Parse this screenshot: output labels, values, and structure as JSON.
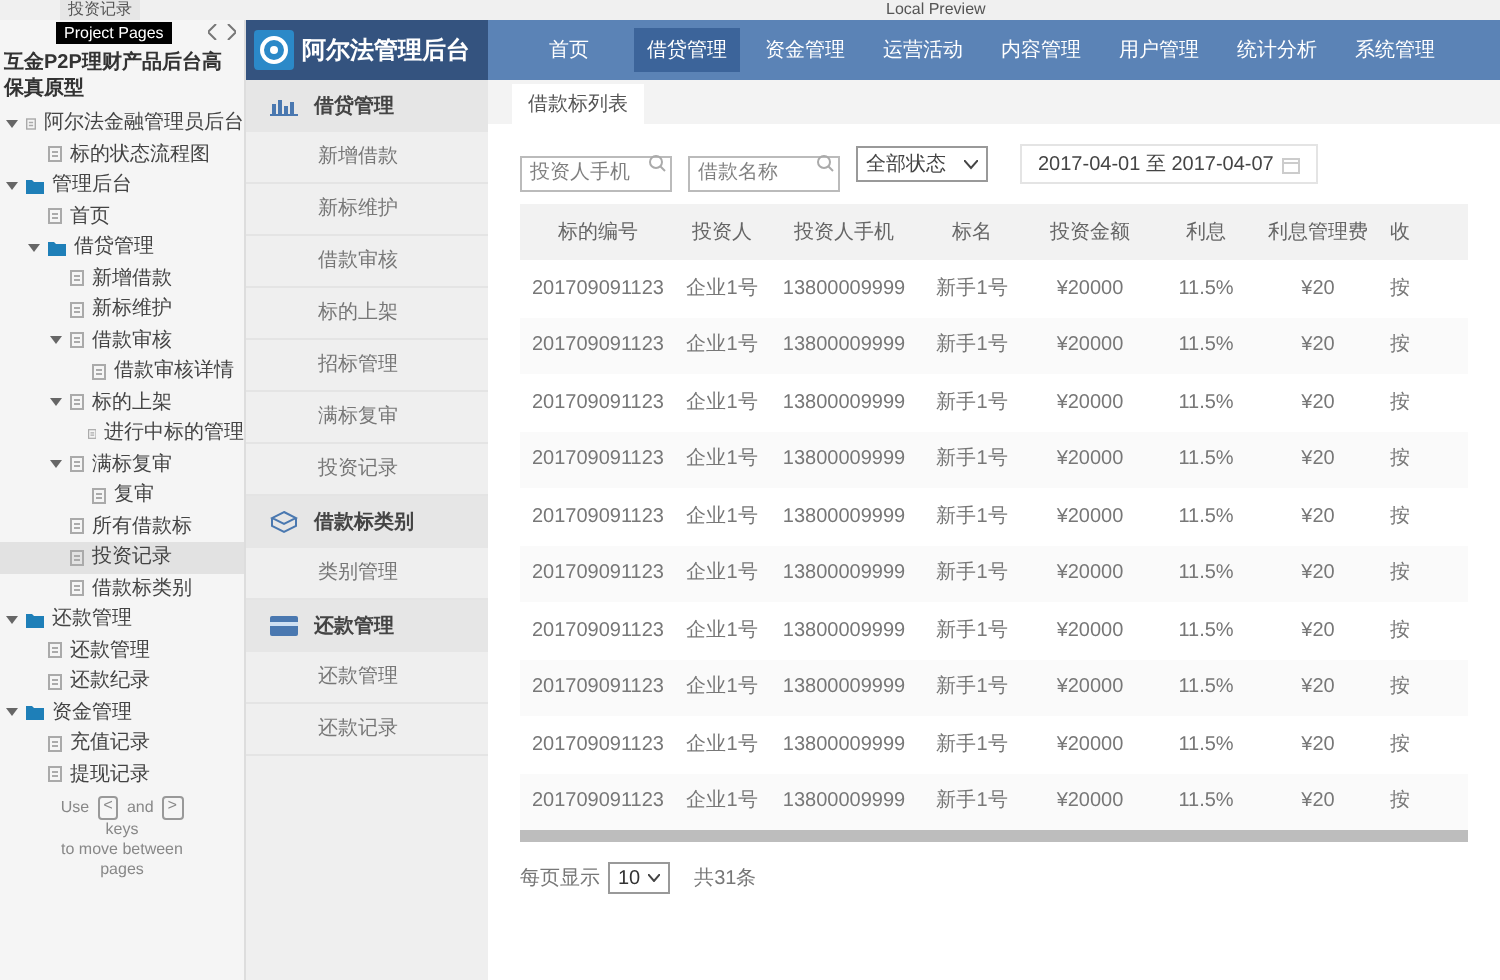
{
  "top_bar": {
    "page_tab": "投资记录",
    "title": "Local Preview"
  },
  "pages_panel": {
    "tooltip": "Project Pages",
    "project_title": "互金P2P理财产品后台高保真原型",
    "tree": [
      {
        "label": "阿尔法金融管理员后台",
        "kind": "page",
        "expanded": true,
        "selected": false,
        "children": [
          {
            "label": "标的状态流程图",
            "kind": "page",
            "selected": false
          }
        ]
      },
      {
        "label": "管理后台",
        "kind": "folder",
        "expanded": true,
        "selected": false,
        "children": [
          {
            "label": "首页",
            "kind": "page",
            "selected": false
          },
          {
            "label": "借贷管理",
            "kind": "folder",
            "expanded": true,
            "selected": false,
            "children": [
              {
                "label": "新增借款",
                "kind": "page",
                "selected": false
              },
              {
                "label": "新标维护",
                "kind": "page",
                "selected": false
              },
              {
                "label": "借款审核",
                "kind": "page",
                "expanded": true,
                "selected": false,
                "children": [
                  {
                    "label": "借款审核详情",
                    "kind": "page",
                    "selected": false
                  }
                ]
              },
              {
                "label": "标的上架",
                "kind": "page",
                "expanded": true,
                "selected": false,
                "children": [
                  {
                    "label": "进行中标的管理",
                    "kind": "page",
                    "selected": false
                  }
                ]
              },
              {
                "label": "满标复审",
                "kind": "page",
                "expanded": true,
                "selected": false,
                "children": [
                  {
                    "label": "复审",
                    "kind": "page",
                    "selected": false
                  }
                ]
              },
              {
                "label": "所有借款标",
                "kind": "page",
                "selected": false
              },
              {
                "label": "投资记录",
                "kind": "page",
                "selected": true
              },
              {
                "label": "借款标类别",
                "kind": "page",
                "selected": false
              }
            ]
          }
        ]
      },
      {
        "label": "还款管理",
        "kind": "folder",
        "expanded": true,
        "selected": false,
        "children": [
          {
            "label": "还款管理",
            "kind": "page",
            "selected": false
          },
          {
            "label": "还款纪录",
            "kind": "page",
            "selected": false
          }
        ]
      },
      {
        "label": "资金管理",
        "kind": "folder",
        "expanded": true,
        "selected": false,
        "children": [
          {
            "label": "充值记录",
            "kind": "page",
            "selected": false
          },
          {
            "label": "提现记录",
            "kind": "page",
            "selected": false
          }
        ]
      }
    ],
    "hint": {
      "before": "Use",
      "prev_key": "<",
      "middle": "and",
      "next_key": ">",
      "line_2": "keys",
      "line_3": "to move between",
      "line_4": "pages"
    }
  },
  "app": {
    "logo_text": "阿尔法管理后台",
    "nav": [
      {
        "label": "首页",
        "selected": false
      },
      {
        "label": "借贷管理",
        "selected": true
      },
      {
        "label": "资金管理",
        "selected": false
      },
      {
        "label": "运营活动",
        "selected": false
      },
      {
        "label": "内容管理",
        "selected": false
      },
      {
        "label": "用户管理",
        "selected": false
      },
      {
        "label": "统计分析",
        "selected": false
      },
      {
        "label": "系统管理",
        "selected": false
      }
    ],
    "sidebar": [
      {
        "label": "借贷管理",
        "kind": "chart",
        "items": [
          {
            "label": "新增借款"
          },
          {
            "label": "新标维护"
          },
          {
            "label": "借款审核"
          },
          {
            "label": "标的上架"
          },
          {
            "label": "招标管理"
          },
          {
            "label": "满标复审"
          },
          {
            "label": "投资记录"
          }
        ]
      },
      {
        "label": "借款标类别",
        "kind": "cube",
        "items": [
          {
            "label": "类别管理"
          }
        ]
      },
      {
        "label": "还款管理",
        "kind": "card",
        "items": [
          {
            "label": "还款管理"
          },
          {
            "label": "还款记录"
          }
        ]
      }
    ],
    "tab": "借款标列表",
    "filters": {
      "phone_placeholder": "投资人手机",
      "name_placeholder": "借款名称",
      "status": "全部状态",
      "date_range": "2017-04-01 至 2017-04-07"
    },
    "table": {
      "columns": [
        "标的编号",
        "投资人",
        "投资人手机",
        "标名",
        "投资金额",
        "利息",
        "利息管理费",
        "收"
      ],
      "rows": [
        [
          "201709091123",
          "企业1号",
          "13800009999",
          "新手1号",
          "¥20000",
          "11.5%",
          "¥20",
          "按"
        ],
        [
          "201709091123",
          "企业1号",
          "13800009999",
          "新手1号",
          "¥20000",
          "11.5%",
          "¥20",
          "按"
        ],
        [
          "201709091123",
          "企业1号",
          "13800009999",
          "新手1号",
          "¥20000",
          "11.5%",
          "¥20",
          "按"
        ],
        [
          "201709091123",
          "企业1号",
          "13800009999",
          "新手1号",
          "¥20000",
          "11.5%",
          "¥20",
          "按"
        ],
        [
          "201709091123",
          "企业1号",
          "13800009999",
          "新手1号",
          "¥20000",
          "11.5%",
          "¥20",
          "按"
        ],
        [
          "201709091123",
          "企业1号",
          "13800009999",
          "新手1号",
          "¥20000",
          "11.5%",
          "¥20",
          "按"
        ],
        [
          "201709091123",
          "企业1号",
          "13800009999",
          "新手1号",
          "¥20000",
          "11.5%",
          "¥20",
          "按"
        ],
        [
          "201709091123",
          "企业1号",
          "13800009999",
          "新手1号",
          "¥20000",
          "11.5%",
          "¥20",
          "按"
        ],
        [
          "201709091123",
          "企业1号",
          "13800009999",
          "新手1号",
          "¥20000",
          "11.5%",
          "¥20",
          "按"
        ],
        [
          "201709091123",
          "企业1号",
          "13800009999",
          "新手1号",
          "¥20000",
          "11.5%",
          "¥20",
          "按"
        ]
      ]
    },
    "pager": {
      "label": "每页显示",
      "page_size": "10",
      "total": "共31条"
    }
  }
}
